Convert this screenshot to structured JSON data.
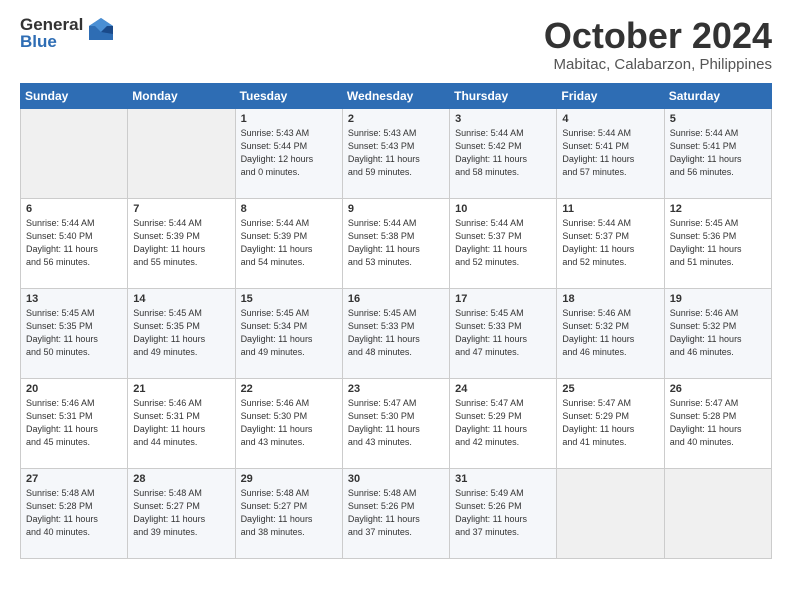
{
  "logo": {
    "general": "General",
    "blue": "Blue"
  },
  "title": "October 2024",
  "subtitle": "Mabitac, Calabarzon, Philippines",
  "headers": [
    "Sunday",
    "Monday",
    "Tuesday",
    "Wednesday",
    "Thursday",
    "Friday",
    "Saturday"
  ],
  "weeks": [
    [
      {
        "day": "",
        "info": ""
      },
      {
        "day": "",
        "info": ""
      },
      {
        "day": "1",
        "info": "Sunrise: 5:43 AM\nSunset: 5:44 PM\nDaylight: 12 hours\nand 0 minutes."
      },
      {
        "day": "2",
        "info": "Sunrise: 5:43 AM\nSunset: 5:43 PM\nDaylight: 11 hours\nand 59 minutes."
      },
      {
        "day": "3",
        "info": "Sunrise: 5:44 AM\nSunset: 5:42 PM\nDaylight: 11 hours\nand 58 minutes."
      },
      {
        "day": "4",
        "info": "Sunrise: 5:44 AM\nSunset: 5:41 PM\nDaylight: 11 hours\nand 57 minutes."
      },
      {
        "day": "5",
        "info": "Sunrise: 5:44 AM\nSunset: 5:41 PM\nDaylight: 11 hours\nand 56 minutes."
      }
    ],
    [
      {
        "day": "6",
        "info": "Sunrise: 5:44 AM\nSunset: 5:40 PM\nDaylight: 11 hours\nand 56 minutes."
      },
      {
        "day": "7",
        "info": "Sunrise: 5:44 AM\nSunset: 5:39 PM\nDaylight: 11 hours\nand 55 minutes."
      },
      {
        "day": "8",
        "info": "Sunrise: 5:44 AM\nSunset: 5:39 PM\nDaylight: 11 hours\nand 54 minutes."
      },
      {
        "day": "9",
        "info": "Sunrise: 5:44 AM\nSunset: 5:38 PM\nDaylight: 11 hours\nand 53 minutes."
      },
      {
        "day": "10",
        "info": "Sunrise: 5:44 AM\nSunset: 5:37 PM\nDaylight: 11 hours\nand 52 minutes."
      },
      {
        "day": "11",
        "info": "Sunrise: 5:44 AM\nSunset: 5:37 PM\nDaylight: 11 hours\nand 52 minutes."
      },
      {
        "day": "12",
        "info": "Sunrise: 5:45 AM\nSunset: 5:36 PM\nDaylight: 11 hours\nand 51 minutes."
      }
    ],
    [
      {
        "day": "13",
        "info": "Sunrise: 5:45 AM\nSunset: 5:35 PM\nDaylight: 11 hours\nand 50 minutes."
      },
      {
        "day": "14",
        "info": "Sunrise: 5:45 AM\nSunset: 5:35 PM\nDaylight: 11 hours\nand 49 minutes."
      },
      {
        "day": "15",
        "info": "Sunrise: 5:45 AM\nSunset: 5:34 PM\nDaylight: 11 hours\nand 49 minutes."
      },
      {
        "day": "16",
        "info": "Sunrise: 5:45 AM\nSunset: 5:33 PM\nDaylight: 11 hours\nand 48 minutes."
      },
      {
        "day": "17",
        "info": "Sunrise: 5:45 AM\nSunset: 5:33 PM\nDaylight: 11 hours\nand 47 minutes."
      },
      {
        "day": "18",
        "info": "Sunrise: 5:46 AM\nSunset: 5:32 PM\nDaylight: 11 hours\nand 46 minutes."
      },
      {
        "day": "19",
        "info": "Sunrise: 5:46 AM\nSunset: 5:32 PM\nDaylight: 11 hours\nand 46 minutes."
      }
    ],
    [
      {
        "day": "20",
        "info": "Sunrise: 5:46 AM\nSunset: 5:31 PM\nDaylight: 11 hours\nand 45 minutes."
      },
      {
        "day": "21",
        "info": "Sunrise: 5:46 AM\nSunset: 5:31 PM\nDaylight: 11 hours\nand 44 minutes."
      },
      {
        "day": "22",
        "info": "Sunrise: 5:46 AM\nSunset: 5:30 PM\nDaylight: 11 hours\nand 43 minutes."
      },
      {
        "day": "23",
        "info": "Sunrise: 5:47 AM\nSunset: 5:30 PM\nDaylight: 11 hours\nand 43 minutes."
      },
      {
        "day": "24",
        "info": "Sunrise: 5:47 AM\nSunset: 5:29 PM\nDaylight: 11 hours\nand 42 minutes."
      },
      {
        "day": "25",
        "info": "Sunrise: 5:47 AM\nSunset: 5:29 PM\nDaylight: 11 hours\nand 41 minutes."
      },
      {
        "day": "26",
        "info": "Sunrise: 5:47 AM\nSunset: 5:28 PM\nDaylight: 11 hours\nand 40 minutes."
      }
    ],
    [
      {
        "day": "27",
        "info": "Sunrise: 5:48 AM\nSunset: 5:28 PM\nDaylight: 11 hours\nand 40 minutes."
      },
      {
        "day": "28",
        "info": "Sunrise: 5:48 AM\nSunset: 5:27 PM\nDaylight: 11 hours\nand 39 minutes."
      },
      {
        "day": "29",
        "info": "Sunrise: 5:48 AM\nSunset: 5:27 PM\nDaylight: 11 hours\nand 38 minutes."
      },
      {
        "day": "30",
        "info": "Sunrise: 5:48 AM\nSunset: 5:26 PM\nDaylight: 11 hours\nand 37 minutes."
      },
      {
        "day": "31",
        "info": "Sunrise: 5:49 AM\nSunset: 5:26 PM\nDaylight: 11 hours\nand 37 minutes."
      },
      {
        "day": "",
        "info": ""
      },
      {
        "day": "",
        "info": ""
      }
    ]
  ]
}
